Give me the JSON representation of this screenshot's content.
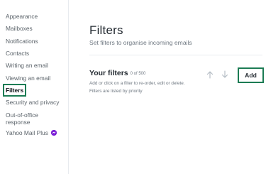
{
  "sidebar": {
    "items": [
      {
        "label": "Appearance"
      },
      {
        "label": "Mailboxes"
      },
      {
        "label": "Notifications"
      },
      {
        "label": "Contacts"
      },
      {
        "label": "Writing an email"
      },
      {
        "label": "Viewing an email"
      },
      {
        "label": "Filters",
        "active": true
      },
      {
        "label": "Security and privacy"
      },
      {
        "label": "Out-of-office",
        "label2": "response"
      },
      {
        "label": "Yahoo Mail Plus",
        "icon": "plus-badge-icon"
      }
    ]
  },
  "main": {
    "title": "Filters",
    "subtitle": "Set filters to organise incoming emails",
    "section": {
      "title": "Your filters",
      "count": "0 of 500",
      "description": "Add or click on a filter to re-order, edit or delete. Filters are listed by priority",
      "move_up_icon": "arrow-up-icon",
      "move_down_icon": "arrow-down-icon",
      "add_label": "Add"
    }
  },
  "colors": {
    "accent_outline": "#1c7c54",
    "plus_badge": "#7b1fd6",
    "text_primary": "#232a31",
    "text_secondary": "#6e7780"
  }
}
